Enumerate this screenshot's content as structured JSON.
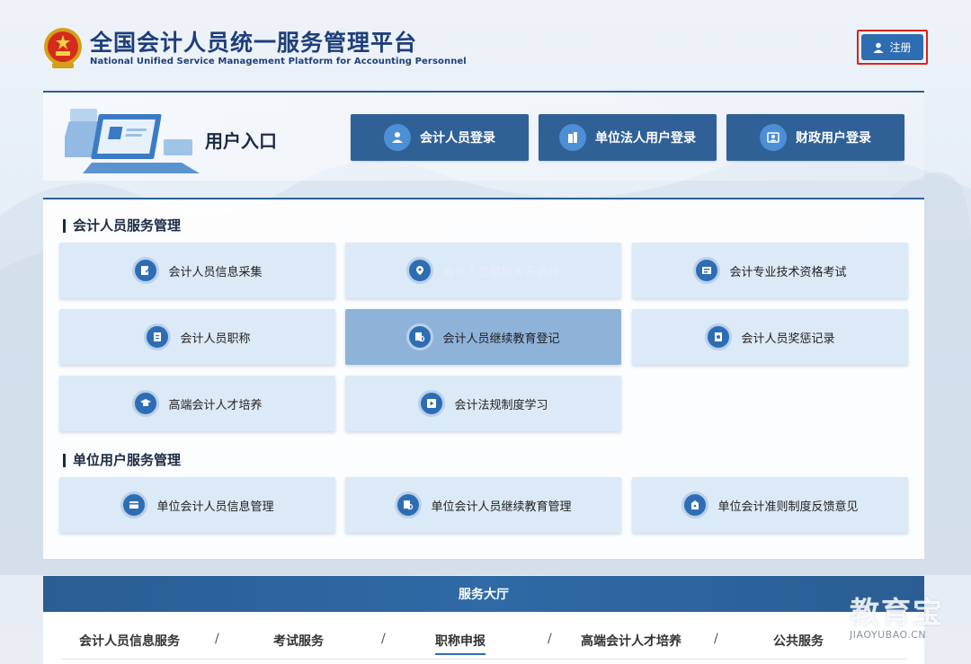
{
  "header": {
    "title_cn": "全国会计人员统一服务管理平台",
    "title_en": "National Unified Service Management Platform for Accounting Personnel",
    "register_label": "注册"
  },
  "entry": {
    "title": "用户入口",
    "buttons": [
      {
        "label": "会计人员登录",
        "icon": "user-icon"
      },
      {
        "label": "单位法人用户登录",
        "icon": "building-icon"
      },
      {
        "label": "财政用户登录",
        "icon": "id-card-icon"
      }
    ]
  },
  "services": {
    "section1_title": "会计人员服务管理",
    "section1_cards": [
      {
        "label": "会计人员信息采集",
        "icon": "edit-form-icon"
      },
      {
        "label": "会计人员属地关系调转",
        "icon": "location-icon"
      },
      {
        "label": "会计专业技术资格考试",
        "icon": "exam-icon"
      },
      {
        "label": "会计人员职称",
        "icon": "document-icon"
      },
      {
        "label": "会计人员继续教育登记",
        "icon": "search-document-icon"
      },
      {
        "label": "会计人员奖惩记录",
        "icon": "record-icon"
      },
      {
        "label": "高端会计人才培养",
        "icon": "graduation-cap-icon"
      },
      {
        "label": "会计法规制度学习",
        "icon": "play-icon"
      }
    ],
    "section2_title": "单位用户服务管理",
    "section2_cards": [
      {
        "label": "单位会计人员信息管理",
        "icon": "card-icon"
      },
      {
        "label": "单位会计人员继续教育管理",
        "icon": "search-document-icon"
      },
      {
        "label": "单位会计准则制度反馈意见",
        "icon": "feedback-icon"
      }
    ]
  },
  "hall": {
    "title": "服务大厅",
    "tabs": [
      "会计人员信息服务",
      "考试服务",
      "职称申报",
      "高端会计人才培养",
      "公共服务"
    ],
    "separator": "/"
  },
  "watermark": {
    "big": "教育宝",
    "small": "JIAOYUBAO.CN"
  },
  "colors": {
    "primary": "#2f6196",
    "accent": "#2f6db3",
    "card_bg": "#dce9f7",
    "card_active": "#8fb2d9",
    "register_outline": "#e02020"
  }
}
